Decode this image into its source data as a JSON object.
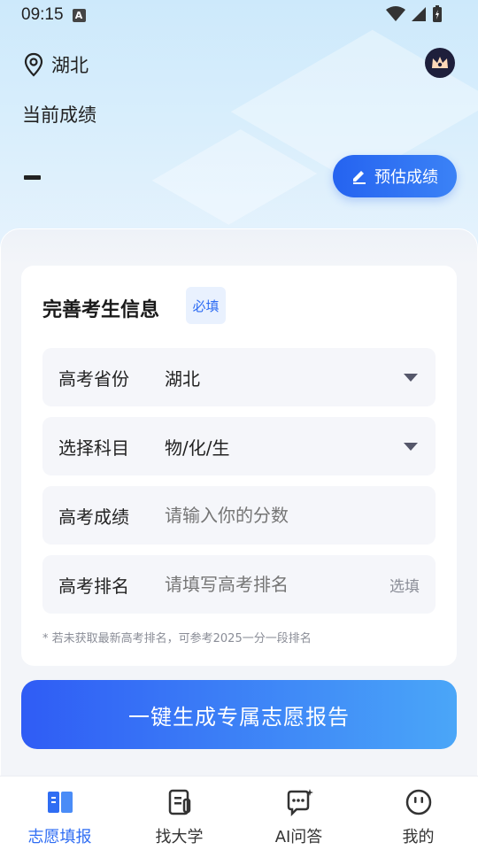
{
  "status_bar": {
    "time": "09:15",
    "a_glyph": "A"
  },
  "location": {
    "icon": "location-pin-icon",
    "name": "湖北"
  },
  "score": {
    "title": "当前成绩",
    "value": "-"
  },
  "estimate_button": {
    "label": "预估成绩",
    "icon": "pencil-icon"
  },
  "form": {
    "title": "完善考生信息",
    "required_tag": "必填",
    "fields": [
      {
        "label": "高考省份",
        "value": "湖北"
      },
      {
        "label": "选择科目",
        "value": "物/化/生"
      },
      {
        "label": "高考成绩",
        "placeholder": "请输入你的分数"
      },
      {
        "label": "高考排名",
        "placeholder": "请填写高考排名",
        "optional": "选填"
      }
    ],
    "note": "* 若未获取最新高考排名，可参考2025一分一段排名"
  },
  "generate_button": {
    "label": "一键生成专属志愿报告"
  },
  "tabbar": {
    "tabs": [
      {
        "label": "志愿填报",
        "icon": "book-icon",
        "active": true
      },
      {
        "label": "找大学",
        "icon": "document-icon"
      },
      {
        "label": "AI问答",
        "icon": "chat-ai-icon"
      },
      {
        "label": "我的",
        "icon": "smiley-icon"
      }
    ]
  },
  "colors": {
    "accent": "#2f6df3",
    "hero_bg": "#d8eefc"
  }
}
